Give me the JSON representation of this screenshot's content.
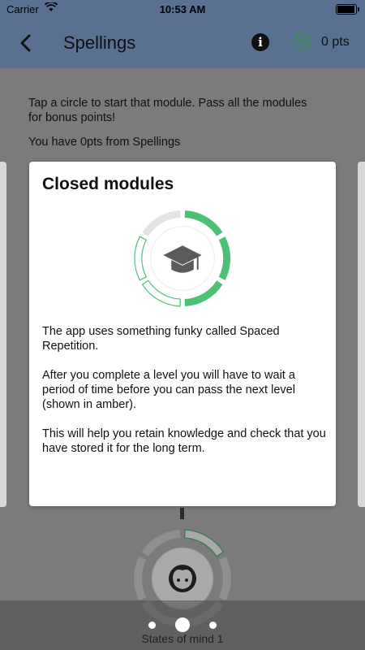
{
  "status_bar": {
    "carrier": "Carrier",
    "time": "10:53 AM"
  },
  "nav": {
    "title": "Spellings",
    "points": "0 pts",
    "info_icon": "i"
  },
  "intro": {
    "text": "Tap a circle to start that module. Pass all the modules for bonus points!",
    "score": "You have 0pts from Spellings"
  },
  "popup": {
    "title": "Closed modules",
    "paragraphs": [
      "The app uses something funky called Spaced Repetition.",
      "After you complete a level you will have to wait a period of time before you can pass the next level (shown in amber).",
      "This will help you retain knowledge and check that you have stored it for the long term."
    ]
  },
  "pager": {
    "label": "States of mind 1",
    "active_index": 1,
    "count": 3
  },
  "colors": {
    "nav_bg": "#5a7090",
    "ring_green": "#4cc173",
    "ring_grey": "#e3e3e3",
    "accent_green": "#3d8c52"
  },
  "icons": {
    "back": "chevron-left-icon",
    "info": "info-icon",
    "points": "points-grid-icon",
    "popup_ring_center": "graduation-cap-icon",
    "module_ring_center": "face-icon"
  }
}
